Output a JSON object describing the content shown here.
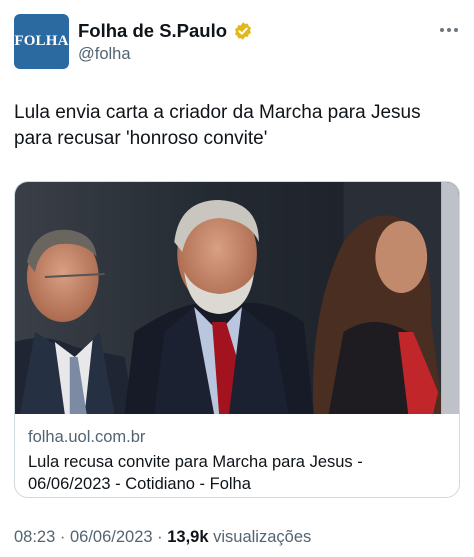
{
  "account": {
    "avatar_text": "FOLHA",
    "display_name": "Folha de S.Paulo",
    "handle": "@folha",
    "verified_color": "#e2b719",
    "avatar_color": "#2a6aa0",
    "more_icon": "more-dots-icon"
  },
  "tweet": {
    "text": "Lula envia carta a criador da Marcha para Jesus para recusar 'honroso convite'"
  },
  "card": {
    "domain": "folha.uol.com.br",
    "title": "Lula recusa convite para Marcha para Jesus - 06/06/2023 - Cotidiano - Folha"
  },
  "meta": {
    "time": "08:23",
    "separator": " · ",
    "date": "06/06/2023",
    "views_count": "13,9k",
    "views_label": " visualizações"
  }
}
